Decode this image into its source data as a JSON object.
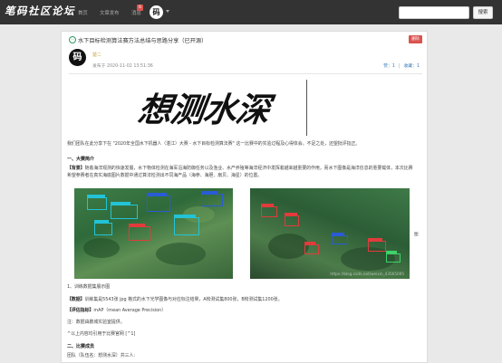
{
  "nav": {
    "brand": "笔码社区论坛",
    "links": [
      "首页",
      "文章发布",
      "消息"
    ],
    "badge_count": "6",
    "avatar_glyph": "码",
    "search_placeholder": "",
    "search_button": "搜索"
  },
  "post": {
    "title": "水下目标检测算法赛方法总结与思路分享（已开源）",
    "delete_label": "删除",
    "author_avatar_glyph": "码",
    "author_name": "楚二",
    "time": "发布于 2020-11-02 13:51:36",
    "like_label": "赞：1",
    "collect_label": "收藏：1",
    "banner_text": "想测水深",
    "intro": "我们团队在此分享下在 \"2020年全国水下机器人（湛江）大赛 - 水下目标检测算法赛\" 这一比赛中的实验过程及心得体会。不足之处，还望批评指正。",
    "section1_heading": "一、大赛简介",
    "bg_label": "【背景】",
    "bg_line1": "随着海洋观测的快速发展，水下物体检测在海军沿海防御任务以及渔业、水产养殖等海洋经济中发挥着越来越重要的作用，而水下图像是海洋信息的重要载体，本次比赛",
    "bg_line2": "希望参赛者在真实海底图片数据中通过算法检测出不同海产品（海参、海胆、扇贝、海星）的位置。",
    "figure_caption": "图",
    "list_item": "1、训练数据集展示图",
    "data_label": "【数据】",
    "data_text": "训练集是5543张 jpg 格式的水下光学图像与对应标注结果，A榜测试集800张，B榜测试集1200张。",
    "metric_label": "【评估指标】",
    "metric_text": "mAP（mean Average Precision）",
    "note": "注：数据由鹏城实验室提供。",
    "note2": "^以上内容均引用于比赛官网 [^1]",
    "section2_heading": "二、比赛成员",
    "team_line": "团队（队伍名：想测水深）共三人:",
    "watermark": "https://blog.csdn.net/weixin_43565095"
  },
  "colors": {
    "nav_bg": "#333333",
    "delete": "#d9534f",
    "link": "#337ab7",
    "box_red": "#e23b3b",
    "box_blue": "#2a5bd6",
    "box_cyan": "#22c3d8",
    "box_green": "#3fd16a"
  }
}
